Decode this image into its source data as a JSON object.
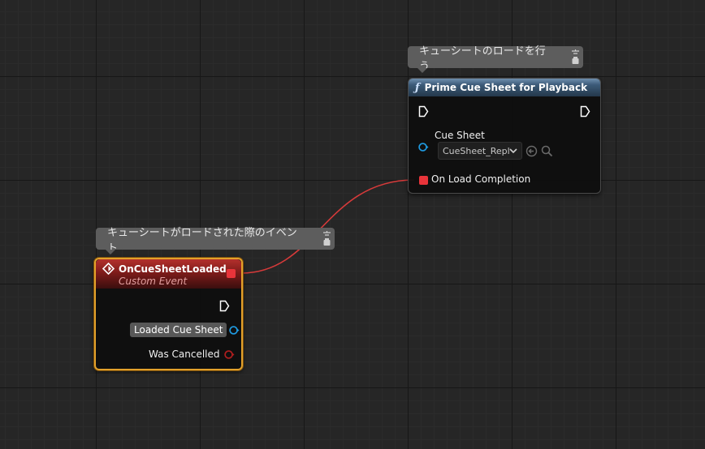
{
  "comments": {
    "prime": "キューシートのロードを行う",
    "event": "キューシートがロードされた際のイベント"
  },
  "prime_node": {
    "title": "Prime Cue Sheet for Playback",
    "cue_sheet_label": "Cue Sheet",
    "cue_sheet_value": "CueSheet_Repl",
    "on_load_label": "On Load Completion"
  },
  "event_node": {
    "title": "OnCueSheetLoaded",
    "subtitle": "Custom Event",
    "loaded_label": "Loaded Cue Sheet",
    "cancelled_label": "Was Cancelled"
  },
  "colors": {
    "delegate_pin": "#e8343a",
    "object_pin": "#1f9ae0",
    "bool_pin": "#9b1b1b",
    "event_border": "#e3a12b"
  }
}
